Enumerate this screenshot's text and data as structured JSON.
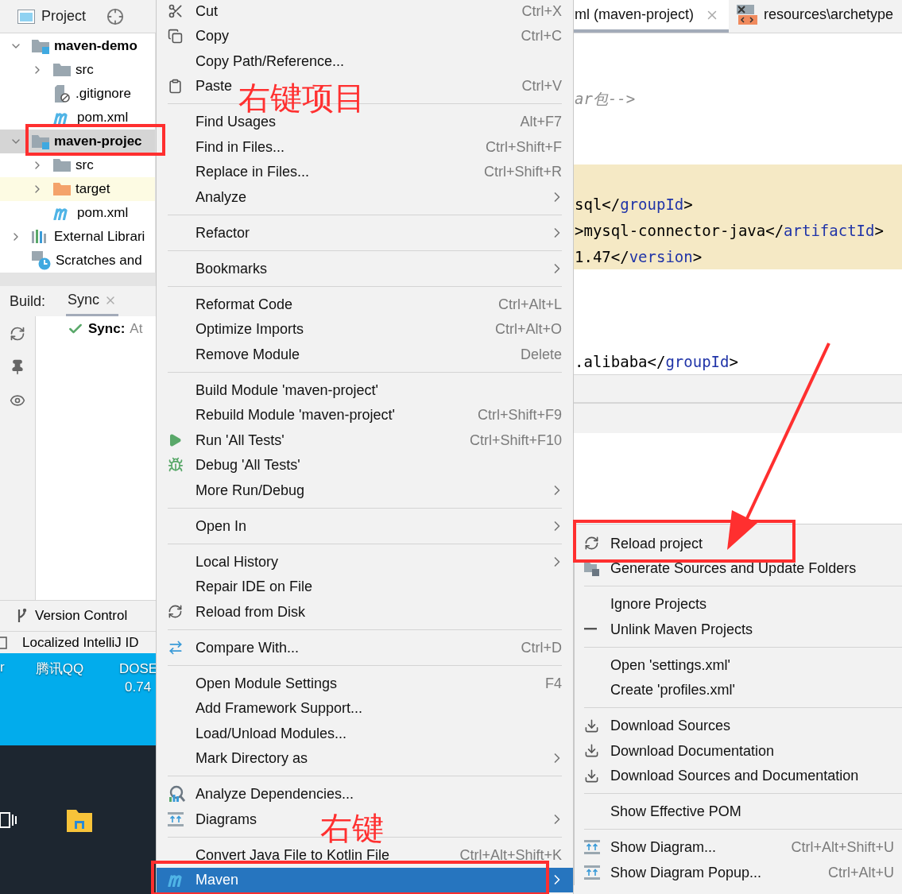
{
  "project_panel": {
    "title": "Project",
    "tree": [
      {
        "kind": "module",
        "label": "maven-demo",
        "expanded": true,
        "selected": false,
        "highlighted": false,
        "children": [
          {
            "kind": "folder",
            "label": "src",
            "expanded": false,
            "selected": false,
            "highlighted": false
          },
          {
            "kind": "ignore-file",
            "label": ".gitignore",
            "selected": false,
            "highlighted": false
          },
          {
            "kind": "maven-file",
            "label": "pom.xml",
            "selected": false,
            "highlighted": false
          }
        ]
      },
      {
        "kind": "module",
        "label": "maven-projec",
        "expanded": true,
        "selected": true,
        "highlighted": false,
        "children": [
          {
            "kind": "folder",
            "label": "src",
            "expanded": false,
            "selected": false,
            "highlighted": false
          },
          {
            "kind": "excluded-folder",
            "label": "target",
            "expanded": false,
            "selected": false,
            "highlighted": true
          },
          {
            "kind": "maven-file",
            "label": "pom.xml",
            "selected": false,
            "highlighted": false
          }
        ]
      },
      {
        "kind": "libraries",
        "label": "External Librari",
        "expanded": false,
        "selected": false,
        "highlighted": false
      },
      {
        "kind": "scratches",
        "label": "Scratches and",
        "selected": false,
        "highlighted": false
      }
    ]
  },
  "build_panel": {
    "label": "Build:",
    "tabs": [
      {
        "label": "Sync",
        "selected": true
      }
    ],
    "rows": [
      {
        "kind": "success",
        "title": "Sync:",
        "text": "At"
      }
    ]
  },
  "tool_window_bar": {
    "label": "Version Control"
  },
  "status_bar": {
    "text": "Localized IntelliJ ID"
  },
  "desktop": {
    "icons": [
      {
        "label": "r"
      },
      {
        "label": "腾讯QQ"
      },
      {
        "label": "DOSE",
        "sublabel": "0.74"
      }
    ]
  },
  "editor": {
    "tabs": [
      {
        "label": "ml (maven-project)",
        "selected": true,
        "closable": true
      },
      {
        "label": "resources\\archetype",
        "selected": false
      }
    ],
    "lines": [
      {
        "highlighted": false
      },
      {
        "highlighted": false
      },
      {
        "highlighted": false,
        "tokens": [
          {
            "kind": "comment",
            "text": "ar包-->"
          }
        ]
      },
      {
        "highlighted": false
      },
      {
        "highlighted": false
      },
      {
        "highlighted": true
      },
      {
        "highlighted": true,
        "tokens": [
          {
            "kind": "text",
            "text": "sql</"
          },
          {
            "kind": "tag",
            "text": "groupId"
          },
          {
            "kind": "text",
            "text": ">"
          }
        ]
      },
      {
        "highlighted": true,
        "tokens": [
          {
            "kind": "text",
            "text": ">mysql-connector-java</"
          },
          {
            "kind": "tag",
            "text": "artifactId"
          },
          {
            "kind": "text",
            "text": ">"
          }
        ]
      },
      {
        "highlighted": true,
        "tokens": [
          {
            "kind": "text",
            "text": "1.47</"
          },
          {
            "kind": "tag",
            "text": "version"
          },
          {
            "kind": "text",
            "text": ">"
          }
        ]
      },
      {
        "highlighted": false
      },
      {
        "highlighted": false
      },
      {
        "highlighted": false
      },
      {
        "highlighted": false,
        "tokens": [
          {
            "kind": "text",
            "text": ".alibaba</"
          },
          {
            "kind": "tag",
            "text": "groupId"
          },
          {
            "kind": "text",
            "text": ">"
          }
        ]
      }
    ]
  },
  "context_menu": {
    "items": [
      {
        "kind": "item",
        "label": "Cut",
        "shortcut": "Ctrl+X",
        "selected": false
      },
      {
        "kind": "item",
        "label": "Copy",
        "shortcut": "Ctrl+C",
        "selected": false
      },
      {
        "kind": "item",
        "label": "Copy Path/Reference...",
        "selected": false
      },
      {
        "kind": "item",
        "label": "Paste",
        "shortcut": "Ctrl+V",
        "selected": false
      },
      {
        "kind": "separator"
      },
      {
        "kind": "item",
        "label": "Find Usages",
        "shortcut": "Alt+F7",
        "selected": false
      },
      {
        "kind": "item",
        "label": "Find in Files...",
        "shortcut": "Ctrl+Shift+F",
        "selected": false
      },
      {
        "kind": "item",
        "label": "Replace in Files...",
        "shortcut": "Ctrl+Shift+R",
        "selected": false
      },
      {
        "kind": "item",
        "label": "Analyze",
        "submenu": true,
        "selected": false
      },
      {
        "kind": "separator"
      },
      {
        "kind": "item",
        "label": "Refactor",
        "submenu": true,
        "selected": false
      },
      {
        "kind": "separator"
      },
      {
        "kind": "item",
        "label": "Bookmarks",
        "submenu": true,
        "selected": false
      },
      {
        "kind": "separator"
      },
      {
        "kind": "item",
        "label": "Reformat Code",
        "shortcut": "Ctrl+Alt+L",
        "selected": false
      },
      {
        "kind": "item",
        "label": "Optimize Imports",
        "shortcut": "Ctrl+Alt+O",
        "selected": false
      },
      {
        "kind": "item",
        "label": "Remove Module",
        "shortcut": "Delete",
        "selected": false
      },
      {
        "kind": "separator"
      },
      {
        "kind": "item",
        "label": "Build Module 'maven-project'",
        "selected": false
      },
      {
        "kind": "item",
        "label": "Rebuild Module 'maven-project'",
        "shortcut": "Ctrl+Shift+F9",
        "selected": false
      },
      {
        "kind": "item",
        "label": "Run 'All Tests'",
        "shortcut": "Ctrl+Shift+F10",
        "selected": false
      },
      {
        "kind": "item",
        "label": "Debug 'All Tests'",
        "selected": false
      },
      {
        "kind": "item",
        "label": "More Run/Debug",
        "submenu": true,
        "selected": false
      },
      {
        "kind": "separator"
      },
      {
        "kind": "item",
        "label": "Open In",
        "submenu": true,
        "selected": false
      },
      {
        "kind": "separator"
      },
      {
        "kind": "item",
        "label": "Local History",
        "submenu": true,
        "selected": false
      },
      {
        "kind": "item",
        "label": "Repair IDE on File",
        "selected": false
      },
      {
        "kind": "item",
        "label": "Reload from Disk",
        "selected": false
      },
      {
        "kind": "separator"
      },
      {
        "kind": "item",
        "label": "Compare With...",
        "shortcut": "Ctrl+D",
        "selected": false
      },
      {
        "kind": "separator"
      },
      {
        "kind": "item",
        "label": "Open Module Settings",
        "shortcut": "F4",
        "selected": false
      },
      {
        "kind": "item",
        "label": "Add Framework Support...",
        "selected": false
      },
      {
        "kind": "item",
        "label": "Load/Unload Modules...",
        "selected": false
      },
      {
        "kind": "item",
        "label": "Mark Directory as",
        "submenu": true,
        "selected": false
      },
      {
        "kind": "separator"
      },
      {
        "kind": "item",
        "label": "Analyze Dependencies...",
        "selected": false
      },
      {
        "kind": "item",
        "label": "Diagrams",
        "submenu": true,
        "selected": false
      },
      {
        "kind": "separator"
      },
      {
        "kind": "item",
        "label": "Convert Java File to Kotlin File",
        "shortcut": "Ctrl+Alt+Shift+K",
        "selected": false
      },
      {
        "kind": "item",
        "label": "Maven",
        "submenu": true,
        "selected": true
      }
    ]
  },
  "maven_submenu": {
    "items": [
      {
        "kind": "item",
        "label": "Reload project",
        "selected": false
      },
      {
        "kind": "item",
        "label": "Generate Sources and Update Folders",
        "selected": false
      },
      {
        "kind": "separator"
      },
      {
        "kind": "item",
        "label": "Ignore Projects",
        "selected": false
      },
      {
        "kind": "item",
        "label": "Unlink Maven Projects",
        "selected": false
      },
      {
        "kind": "separator"
      },
      {
        "kind": "item",
        "label": "Open 'settings.xml'",
        "selected": false
      },
      {
        "kind": "item",
        "label": "Create 'profiles.xml'",
        "selected": false
      },
      {
        "kind": "separator"
      },
      {
        "kind": "item",
        "label": "Download Sources",
        "selected": false
      },
      {
        "kind": "item",
        "label": "Download Documentation",
        "selected": false
      },
      {
        "kind": "item",
        "label": "Download Sources and Documentation",
        "selected": false
      },
      {
        "kind": "separator"
      },
      {
        "kind": "item",
        "label": "Show Effective POM",
        "selected": false
      },
      {
        "kind": "separator"
      },
      {
        "kind": "item",
        "label": "Show Diagram...",
        "shortcut": "Ctrl+Alt+Shift+U",
        "selected": false
      },
      {
        "kind": "item",
        "label": "Show Diagram Popup...",
        "shortcut": "Ctrl+Alt+U",
        "selected": false
      }
    ]
  },
  "annotations": [
    "右键项目",
    "右键"
  ]
}
